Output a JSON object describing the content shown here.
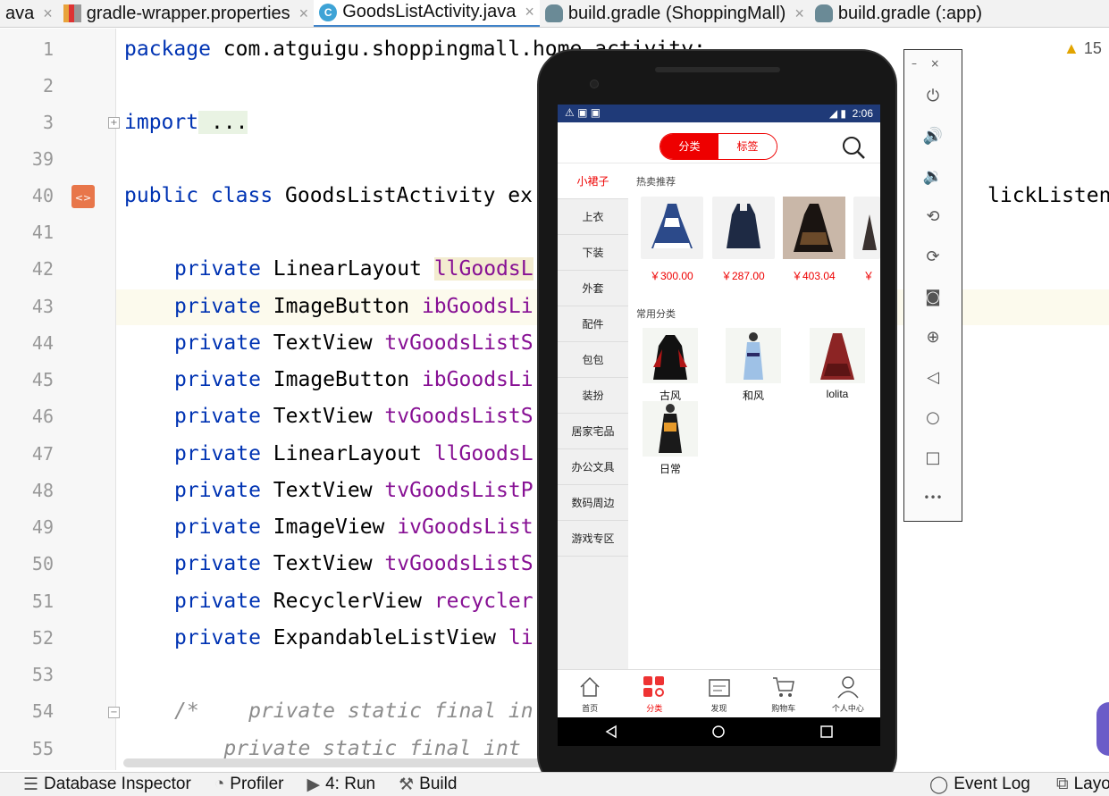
{
  "tabs": [
    {
      "label": "ava",
      "icon": "none"
    },
    {
      "label": "gradle-wrapper.properties",
      "icon": "properties-file-icon"
    },
    {
      "label": "GoodsListActivity.java",
      "icon": "java-class-icon",
      "active": true
    },
    {
      "label": "build.gradle (ShoppingMall)",
      "icon": "gradle-icon"
    },
    {
      "label": "build.gradle (:app)",
      "icon": "gradle-icon"
    }
  ],
  "tab_close": "×",
  "warnings": {
    "icon": "▲",
    "count": "15"
  },
  "code": {
    "l1": {
      "num": "1",
      "kw": "package",
      "rest": " com.atguigu.shoppingmall.home.activity;"
    },
    "l2": {
      "num": "2"
    },
    "l3": {
      "num": "3",
      "kw": "import",
      "rest": " ..."
    },
    "l39": {
      "num": "39"
    },
    "l40": {
      "num": "40",
      "kw": "public class",
      "rest": " GoodsListActivity ex",
      "tail": "lickListener"
    },
    "l41": {
      "num": "41"
    },
    "l42": {
      "num": "42",
      "kw": "private",
      "type": " LinearLayout ",
      "fld": "llGoodsL"
    },
    "l43": {
      "num": "43",
      "kw": "private",
      "type": " ImageButton ",
      "fld": "ibGoodsLi"
    },
    "l44": {
      "num": "44",
      "kw": "private",
      "type": " TextView ",
      "fld": "tvGoodsListS"
    },
    "l45": {
      "num": "45",
      "kw": "private",
      "type": " ImageButton ",
      "fld": "ibGoodsLi"
    },
    "l46": {
      "num": "46",
      "kw": "private",
      "type": " TextView ",
      "fld": "tvGoodsListS"
    },
    "l47": {
      "num": "47",
      "kw": "private",
      "type": " LinearLayout ",
      "fld": "llGoodsL"
    },
    "l48": {
      "num": "48",
      "kw": "private",
      "type": " TextView ",
      "fld": "tvGoodsListP"
    },
    "l49": {
      "num": "49",
      "kw": "private",
      "type": " ImageView ",
      "fld": "ivGoodsList"
    },
    "l50": {
      "num": "50",
      "kw": "private",
      "type": " TextView ",
      "fld": "tvGoodsListS"
    },
    "l51": {
      "num": "51",
      "kw": "private",
      "type": " RecyclerView ",
      "fld": "recycler"
    },
    "l52": {
      "num": "52",
      "kw": "private",
      "type": " ExpandableListView ",
      "fld": "li"
    },
    "l53": {
      "num": "53"
    },
    "l54": {
      "num": "54",
      "cmt": "/*    private static final in"
    },
    "l55": {
      "num": "55",
      "cmt": "    private static final int "
    }
  },
  "phone": {
    "status_time": "2:06",
    "seg_left": "分类",
    "seg_right": "标签",
    "nav": [
      "小裙子",
      "上衣",
      "下装",
      "外套",
      "配件",
      "包包",
      "装扮",
      "居家宅品",
      "办公文具",
      "数码周边",
      "游戏专区"
    ],
    "hot_title": "热卖推荐",
    "prices": [
      "￥300.00",
      "￥287.00",
      "￥403.04",
      "￥"
    ],
    "common_title": "常用分类",
    "categories": [
      "古风",
      "和风",
      "lolita",
      "日常"
    ],
    "bottom_nav": [
      "首页",
      "分类",
      "发现",
      "购物车",
      "个人中心"
    ],
    "accent": "#e00000",
    "status_color": "#1f3a78"
  },
  "emulator": {
    "minimize": "–",
    "close": "×",
    "more": "•••"
  },
  "statusbar": {
    "items": [
      "Database Inspector",
      "Profiler",
      "4: Run",
      "Build"
    ],
    "event_log": "Event Log",
    "layout": "Layo"
  }
}
